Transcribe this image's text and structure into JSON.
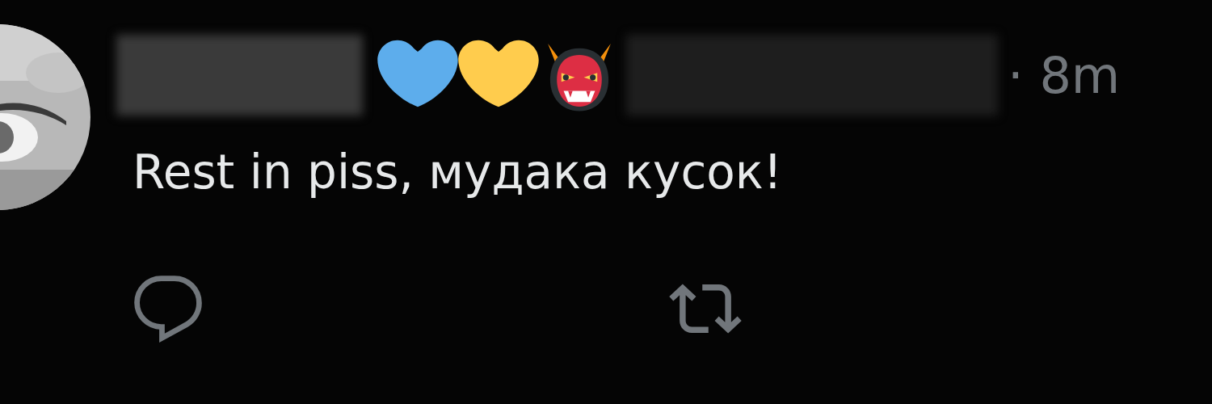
{
  "post": {
    "display_name": {
      "redacted": true
    },
    "name_emojis": [
      {
        "kind": "heart",
        "color": "#5dadec"
      },
      {
        "kind": "heart",
        "color": "#ffcc4d"
      },
      {
        "kind": "ogre"
      }
    ],
    "handle": {
      "redacted": true
    },
    "time": "· 8m",
    "text": "Rest in piss, мудака кусок!",
    "actions": [
      {
        "kind": "reply"
      },
      {
        "kind": "repost"
      }
    ]
  }
}
